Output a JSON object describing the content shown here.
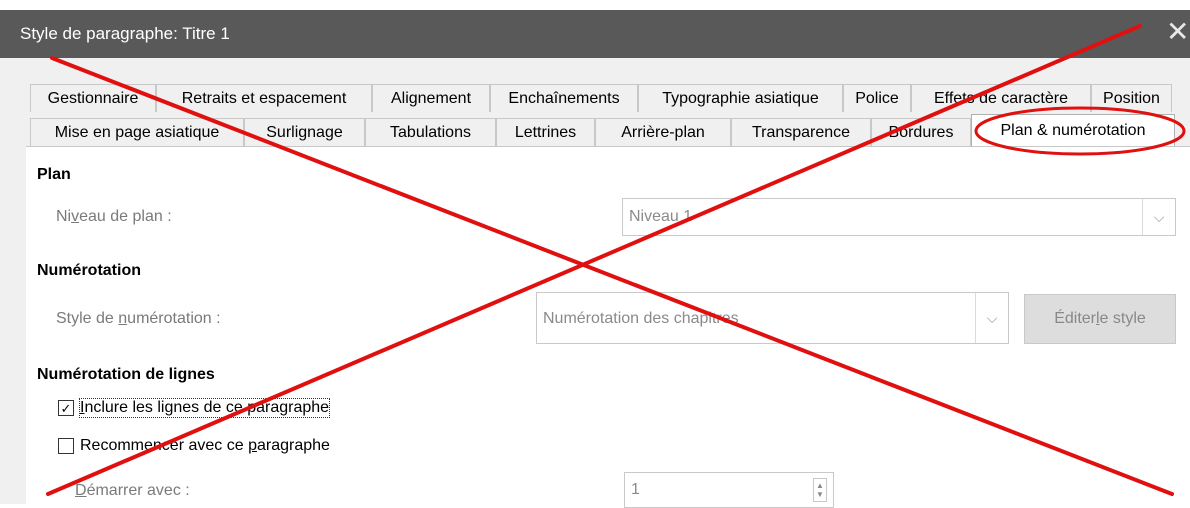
{
  "window": {
    "title": "Style de paragraphe: Titre 1"
  },
  "tabs": {
    "row1": [
      "Gestionnaire",
      "Retraits et espacement",
      "Alignement",
      "Enchaînements",
      "Typographie asiatique",
      "Police",
      "Effets de caractère",
      "Position"
    ],
    "row2": [
      "Mise en page asiatique",
      "Surlignage",
      "Tabulations",
      "Lettrines",
      "Arrière-plan",
      "Transparence",
      "Bordures",
      "Plan & numérotation"
    ],
    "active": "Plan & numérotation"
  },
  "plan": {
    "heading": "Plan",
    "level_label_pre": "Ni",
    "level_label_u": "v",
    "level_label_post": "eau de plan :",
    "level_value": "Niveau 1"
  },
  "numbering": {
    "heading": "Numérotation",
    "style_label_pre": "Style de ",
    "style_label_u": "n",
    "style_label_post": "umérotation :",
    "style_value": "Numérotation des chapitres",
    "edit_pre": "Éditer ",
    "edit_u": "l",
    "edit_post": "e style"
  },
  "line_numbering": {
    "heading": "Numérotation de lignes",
    "include_u": "I",
    "include_rest": "nclure les lignes de ce paragraphe",
    "include_checked": true,
    "restart_pre": "Recommencer avec ce ",
    "restart_u": "p",
    "restart_post": "aragraphe",
    "restart_checked": false,
    "start_u": "D",
    "start_rest": "émarrer avec :",
    "start_value": "1"
  },
  "colors": {
    "titlebar": "#595959",
    "annotation": "#e01010"
  }
}
